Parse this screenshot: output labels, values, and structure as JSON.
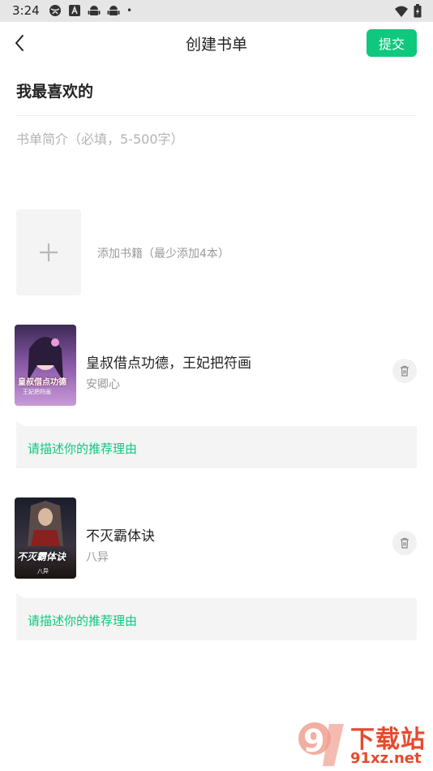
{
  "status_bar": {
    "time": "3:24",
    "dot": "•",
    "icons": [
      "globe-icon",
      "font-a-icon",
      "android-icon",
      "android-icon"
    ],
    "right_icons": [
      "wifi-icon",
      "battery-icon"
    ]
  },
  "header": {
    "title": "创建书单",
    "submit_label": "提交",
    "accent_color": "#0fc87e"
  },
  "list": {
    "name": "我最喜欢的",
    "intro_placeholder": "书单简介（必填，5-500字）",
    "intro_value": ""
  },
  "add_book": {
    "hint": "添加书籍（最少添加4本）"
  },
  "books": [
    {
      "title": "皇叔借点功德，王妃把符画",
      "author": "安卿心",
      "cover_text": "皇叔借点功德",
      "cover_sub": "王妃把符画",
      "reason_placeholder": "请描述你的推荐理由"
    },
    {
      "title": "不灭霸体诀",
      "author": "八异",
      "cover_text": "不灭霸体诀",
      "cover_sub": "八异",
      "reason_placeholder": "请描述你的推荐理由"
    }
  ],
  "watermark": {
    "line1": "下载站",
    "line2": "91xz.net",
    "logo_mark": "9"
  }
}
